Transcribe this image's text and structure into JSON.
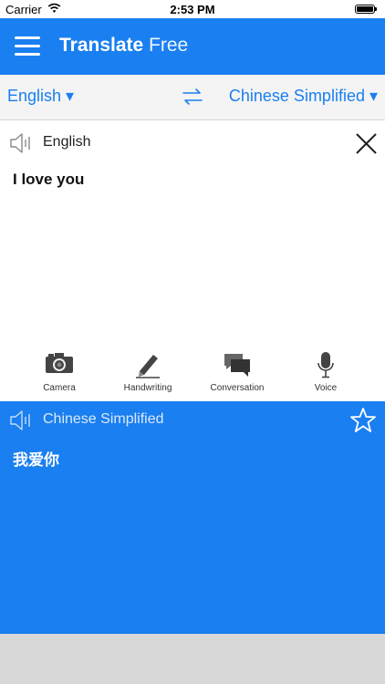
{
  "status": {
    "carrier": "Carrier",
    "time": "2:53 PM"
  },
  "header": {
    "title_bold": "Translate",
    "title_light": " Free"
  },
  "languages": {
    "source": "English ▾",
    "target": "Chinese Simplified ▾"
  },
  "source_panel": {
    "language": "English",
    "text": "I love you"
  },
  "tools": [
    {
      "label": "Camera",
      "icon": "camera-icon"
    },
    {
      "label": "Handwriting",
      "icon": "pencil-icon"
    },
    {
      "label": "Conversation",
      "icon": "chat-bubbles-icon"
    },
    {
      "label": "Voice",
      "icon": "microphone-icon"
    }
  ],
  "target_panel": {
    "language": "Chinese Simplified",
    "text": "我爱你"
  },
  "colors": {
    "accent": "#1a7ff0",
    "lang_bar_bg": "#f4f4f4",
    "bottom_bg": "#d8d8d8"
  }
}
